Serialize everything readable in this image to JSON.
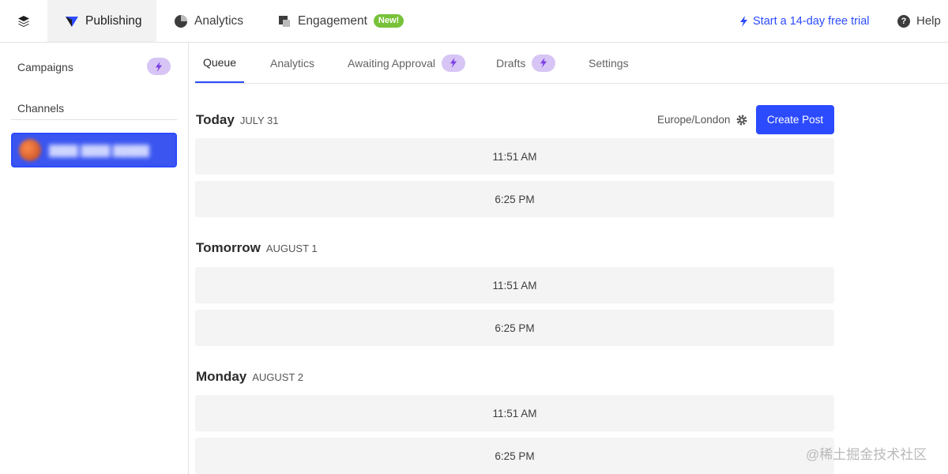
{
  "topbar": {
    "logo_icon": "stack-layers-icon",
    "tabs": [
      {
        "label": "Publishing",
        "icon": "publishing-icon",
        "active": true
      },
      {
        "label": "Analytics",
        "icon": "pie-chart-icon",
        "active": false
      },
      {
        "label": "Engagement",
        "icon": "engagement-icon",
        "active": false,
        "badge": "New!"
      }
    ],
    "trial_label": "Start a 14-day free trial",
    "help_label": "Help"
  },
  "sidebar": {
    "campaigns_label": "Campaigns",
    "channels_label": "Channels"
  },
  "subtabs": [
    {
      "label": "Queue",
      "active": true
    },
    {
      "label": "Analytics"
    },
    {
      "label": "Awaiting Approval",
      "pro": true
    },
    {
      "label": "Drafts",
      "pro": true
    },
    {
      "label": "Settings"
    }
  ],
  "queue": {
    "timezone": "Europe/London",
    "create_label": "Create Post",
    "days": [
      {
        "name": "Today",
        "date": "JULY 31",
        "slots": [
          "11:51 AM",
          "6:25 PM"
        ]
      },
      {
        "name": "Tomorrow",
        "date": "AUGUST 1",
        "slots": [
          "11:51 AM",
          "6:25 PM"
        ]
      },
      {
        "name": "Monday",
        "date": "AUGUST 2",
        "slots": [
          "11:51 AM",
          "6:25 PM"
        ]
      }
    ]
  },
  "colors": {
    "accent": "#2c4bff",
    "badge_new": "#78c23a",
    "pro_pill": "#d7c5f5",
    "slot_bg": "#f4f4f4"
  },
  "watermark": "@稀土掘金技术社区"
}
